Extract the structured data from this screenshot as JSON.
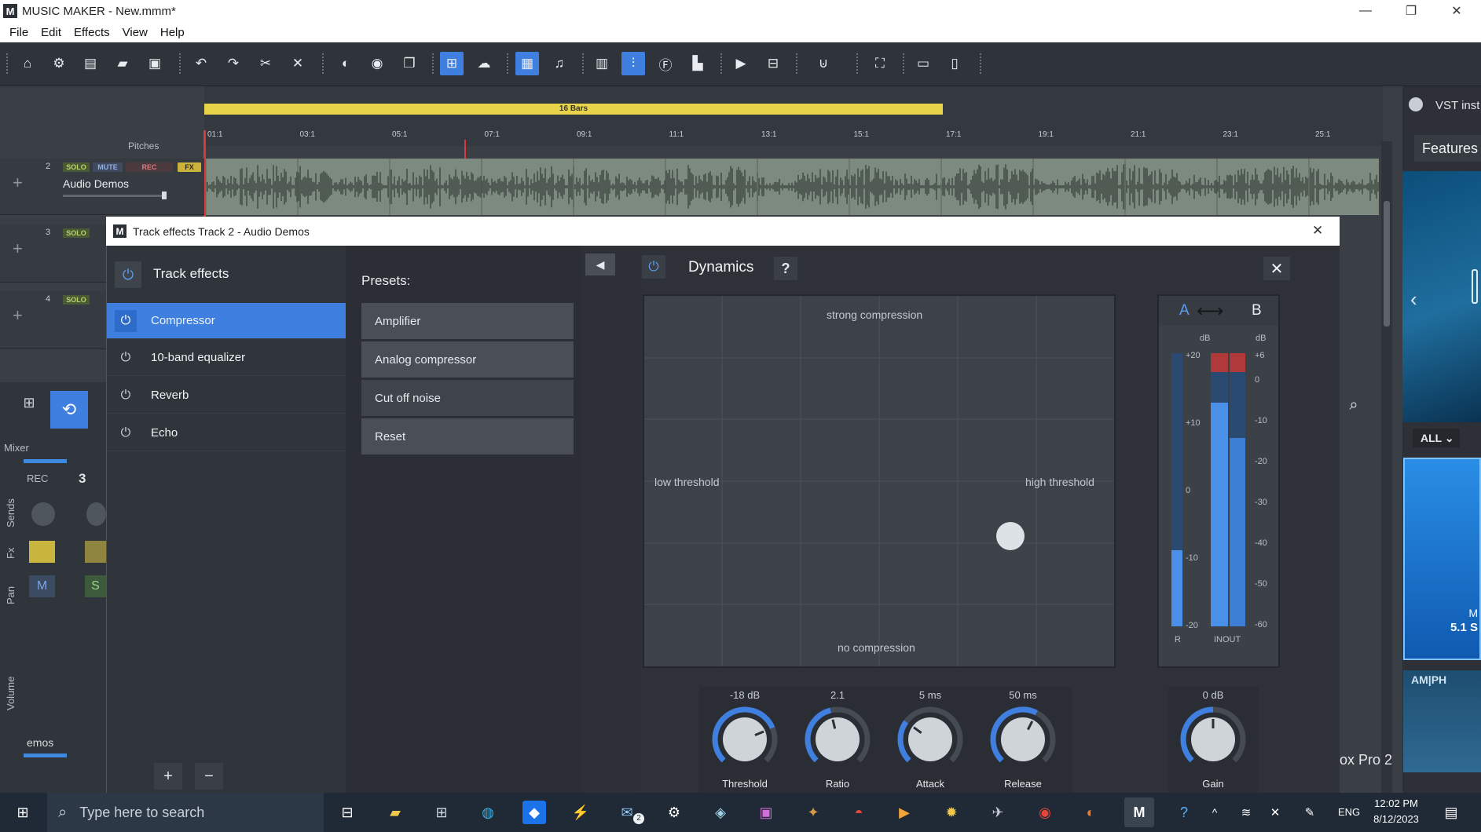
{
  "window": {
    "title": "MUSIC MAKER - New.mmm*",
    "logo": "M",
    "minimize": "—",
    "maximize": "❐",
    "close": "✕"
  },
  "menu": [
    "File",
    "Edit",
    "Effects",
    "View",
    "Help"
  ],
  "ruler": {
    "loop_label": "16 Bars",
    "ticks": [
      "01:1",
      "03:1",
      "05:1",
      "07:1",
      "09:1",
      "11:1",
      "13:1",
      "15:1",
      "17:1",
      "19:1",
      "21:1",
      "23:1",
      "25:1"
    ],
    "pitches_label": "Pitches"
  },
  "tracks": [
    {
      "number": "2",
      "name": "Audio Demos",
      "solo": "SOLO",
      "mute": "MUTE",
      "rec": "REC",
      "fx": "FX"
    },
    {
      "number": "3",
      "solo": "SOLO"
    },
    {
      "number": "4",
      "solo": "SOLO"
    }
  ],
  "mixer": {
    "label": "Mixer",
    "rec": "REC",
    "channel": "3",
    "sends": "Sends",
    "fx": "Fx",
    "pan": "Pan",
    "volume": "Volume",
    "m": "M",
    "s": "S",
    "demos": "emos"
  },
  "side_panel": {
    "vst_label": "VST inst",
    "features": "Features",
    "all_filter": "ALL",
    "product_line1": "M",
    "product_line2": "5.1 S",
    "product_footer": "ox Pro 2",
    "product_header": "AM|PH"
  },
  "dialog": {
    "title": "Track effects  Track 2  - Audio Demos",
    "effects_header": "Track effects",
    "effects": [
      "Compressor",
      "10-band equalizer",
      "Reverb",
      "Echo"
    ],
    "selected_effect": "Compressor",
    "presets_label": "Presets:",
    "presets": [
      "Amplifier",
      "Analog compressor",
      "Cut off noise",
      "Reset"
    ],
    "add": "+",
    "remove": "−"
  },
  "dynamics": {
    "title": "Dynamics",
    "help": "?",
    "back": "◀",
    "close": "✕",
    "graph": {
      "top": "strong compression",
      "bottom": "no compression",
      "left": "low threshold",
      "right": "high threshold"
    },
    "ab": {
      "a": "A",
      "b": "B",
      "arrow": "⟷"
    },
    "meter": {
      "left_unit": "dB",
      "right_unit": "dB",
      "left_scale": [
        "+20",
        "+10",
        "0",
        "-10",
        "-20"
      ],
      "right_scale": [
        "+6",
        "0",
        "-10",
        "-20",
        "-30",
        "-40",
        "-50",
        "-60"
      ],
      "r_label": "R",
      "inout_label": "INOUT",
      "levels": {
        "r": 0.28,
        "in": 0.88,
        "out": 0.74
      }
    },
    "knobs": [
      {
        "value": "-18 dB",
        "label": "Threshold",
        "fill": 0.75
      },
      {
        "value": "2.1",
        "label": "Ratio",
        "fill": 0.45
      },
      {
        "value": "5 ms",
        "label": "Attack",
        "fill": 0.3
      },
      {
        "value": "50 ms",
        "label": "Release",
        "fill": 0.6
      }
    ],
    "gain": {
      "value": "0 dB",
      "label": "Gain",
      "fill": 0.5
    }
  },
  "taskbar": {
    "search_placeholder": "Type here to search",
    "time": "12:02 PM",
    "date": "8/12/2023",
    "lang": "ENG",
    "mail_badge": "2",
    "active_app": "M"
  },
  "colors": {
    "accent": "#3f7fe0",
    "loop": "#e8d448",
    "rec_red": "#d83a3a",
    "meter_blue": "#4a8fe8"
  }
}
